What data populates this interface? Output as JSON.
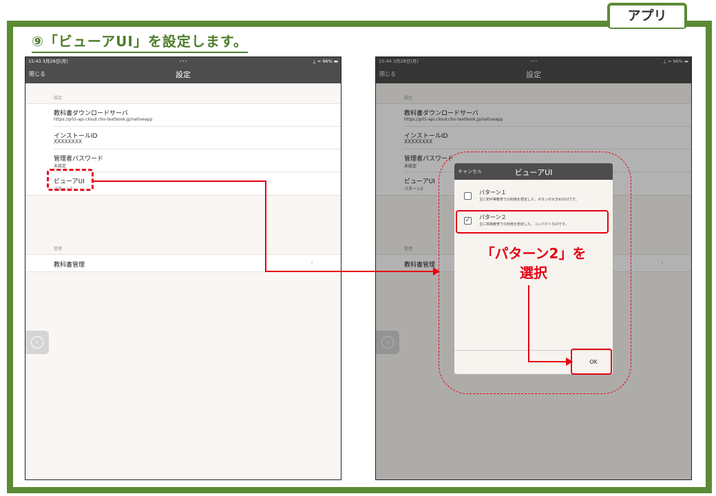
{
  "header": {
    "tab_label": "アプリ",
    "step_title": "⑨「ビューアUI」を設定します。"
  },
  "left_device": {
    "status": {
      "time": "15:43  3月28日(月)",
      "dots": "•••",
      "battery": "⟂ ≈ 96% ▬"
    },
    "nav": {
      "close_label": "閉じる",
      "title": "設定"
    },
    "section1_label": "設定",
    "items": [
      {
        "title": "教科書ダウンロードサーバ",
        "sub": "https://p01-api.cloud.cho-textbook.jp/nativeapp"
      },
      {
        "title": "インストールID",
        "sub": "XXXXXXXX"
      },
      {
        "title": "管理者パスワード",
        "sub": "未設定"
      },
      {
        "title": "ビューアUI",
        "sub": "パターン2"
      }
    ],
    "section2_label": "管理",
    "manage_item": "教科書管理",
    "chevron": "›",
    "side_arrow": "›"
  },
  "right_device": {
    "status": {
      "time": "15:44  3月28日(月)",
      "dots": "•••",
      "battery": "⟂ ≈ 96% ▬"
    },
    "nav": {
      "close_label": "閉じる",
      "title": "設定"
    },
    "section1_label": "設定",
    "items": [
      {
        "title": "教科書ダウンロードサーバ",
        "sub": "https://p01-api.cloud.cho-textbook.jp/nativeapp"
      },
      {
        "title": "インストールID",
        "sub": "XXXXXXXX"
      },
      {
        "title": "管理者パスワード",
        "sub": "未設定"
      },
      {
        "title": "ビューアUI",
        "sub": "パターン2"
      }
    ],
    "section2_label": "管理",
    "manage_item": "教科書管理",
    "chevron": "›",
    "side_arrow": "›",
    "modal": {
      "cancel_label": "キャンセル",
      "title": "ビューアUI",
      "options": [
        {
          "label": "パターン１",
          "desc": "主に初中等教育での利用を想定した、ボタンが大きめのUIです。",
          "checked": false
        },
        {
          "label": "パターン２",
          "desc": "主に高等教育での利用を想定した、コンパクトなUIです。",
          "checked": true
        }
      ],
      "ok_label": "OK",
      "check_mark": "✓"
    }
  },
  "annotation": {
    "line1": "「パターン2」を",
    "line2": "選択",
    "color": "#e60012"
  }
}
